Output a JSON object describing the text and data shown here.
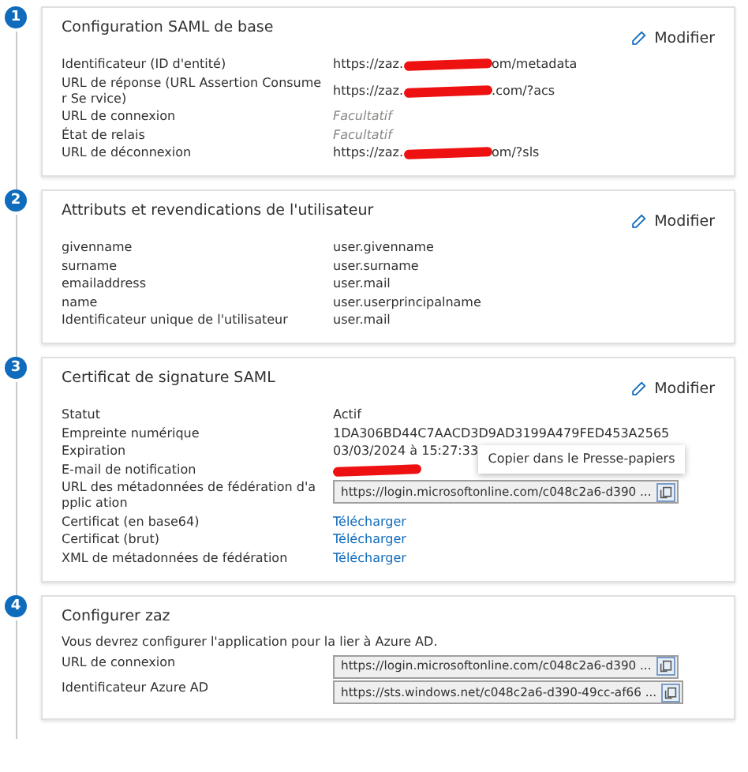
{
  "steps": [
    {
      "number": "1",
      "title": "Configuration SAML de base",
      "edit": "Modifier",
      "rows": [
        {
          "label": "Identificateur (ID d'entité)",
          "kind": "redacted",
          "value": "https://zaz.",
          "value_end": "om/metadata"
        },
        {
          "label": "URL de réponse (URL Assertion Consumer Se rvice)",
          "kind": "redacted",
          "value": "https://zaz.",
          "value_end": ".com/?acs"
        },
        {
          "label": "URL de connexion",
          "kind": "hint",
          "value": "Facultatif"
        },
        {
          "label": "État de relais",
          "kind": "hint",
          "value": "Facultatif"
        },
        {
          "label": "URL de déconnexion",
          "kind": "redacted",
          "value": "https://zaz.",
          "value_end": "om/?sls"
        }
      ]
    },
    {
      "number": "2",
      "title": "Attributs et revendications de l'utilisateur",
      "edit": "Modifier",
      "rows": [
        {
          "label": "givenname",
          "kind": "text",
          "value": "user.givenname"
        },
        {
          "label": "surname",
          "kind": "text",
          "value": "user.surname"
        },
        {
          "label": "emailaddress",
          "kind": "text",
          "value": "user.mail"
        },
        {
          "label": "name",
          "kind": "text",
          "value": "user.userprincipalname"
        },
        {
          "label": "Identificateur unique de l'utilisateur",
          "kind": "text",
          "value": "user.mail"
        }
      ]
    },
    {
      "number": "3",
      "title": "Certificat de signature SAML",
      "edit": "Modifier",
      "rows": [
        {
          "label": "Statut",
          "kind": "text",
          "value": "Actif"
        },
        {
          "label": "Empreinte numérique",
          "kind": "text",
          "value": "1DA306BD44C7AACD3D9AD3199A479FED453A2565"
        },
        {
          "label": "Expiration",
          "kind": "text",
          "value": "03/03/2024 à 15:27:33"
        },
        {
          "label": "E-mail de notification",
          "kind": "redacted",
          "value": "",
          "value_end": ""
        },
        {
          "label": "URL des métadonnées de fédération d'applic ation",
          "kind": "copy",
          "value": "https://login.microsoftonline.com/c048c2a6-d390 ...",
          "tooltip": "Copier dans le Presse-papiers"
        },
        {
          "label": "Certificat (en base64)",
          "kind": "link",
          "value": "Télécharger"
        },
        {
          "label": "Certificat (brut)",
          "kind": "link",
          "value": "Télécharger"
        },
        {
          "label": "XML de métadonnées de fédération",
          "kind": "link",
          "value": "Télécharger"
        }
      ]
    },
    {
      "number": "4",
      "title": "Configurer zaz",
      "intro": "Vous devrez configurer l'application pour la lier à Azure AD.",
      "rows": [
        {
          "label": "URL de connexion",
          "kind": "copy",
          "value": "https://login.microsoftonline.com/c048c2a6-d390 ..."
        },
        {
          "label": "Identificateur Azure AD",
          "kind": "copy",
          "value": "https://sts.windows.net/c048c2a6-d390-49cc-af66 ..."
        }
      ]
    }
  ]
}
